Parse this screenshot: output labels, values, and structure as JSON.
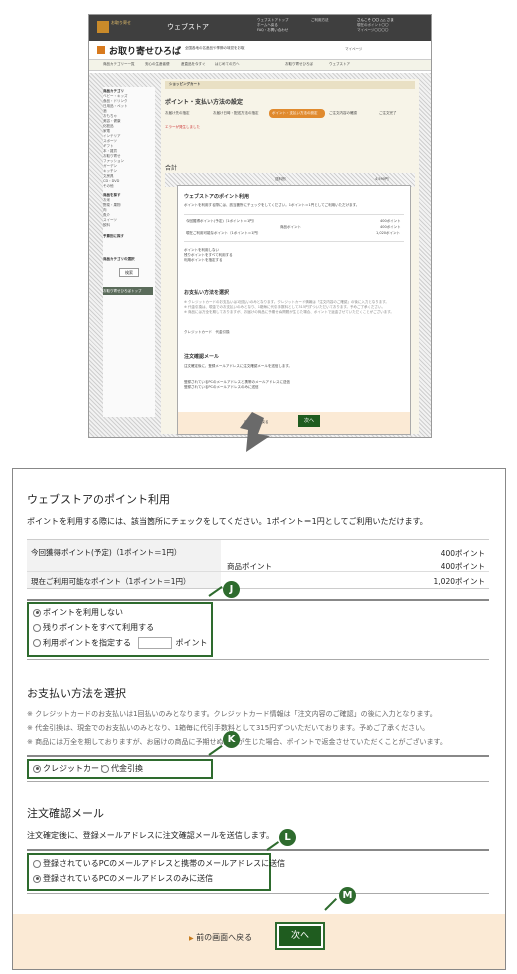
{
  "thumbnail": {
    "site_name": "ウェブストア",
    "header_links": [
      "ウェブストアトップ",
      "ご利用方法",
      "ホームへ戻る",
      "FAQ・お問い合わせ"
    ],
    "header_user": "さんこそ 〇〇 △△ さま",
    "header_user_sub": [
      "現在のポイント〇〇",
      "マイページ〇〇〇〇"
    ],
    "mypage": "マイページ",
    "section_title": "お取り寄せひろば",
    "section_desc": "全国各地の名産品や季節の味覚をお取り寄せ",
    "nav_items": [
      "商品カテゴリー一覧",
      "安心の生産者便",
      "産直品を今すぐ",
      "はじめての方へ"
    ],
    "nav_right": [
      "お取り寄せひろば",
      "ウェブストア"
    ],
    "sidebar_title": "商品カテゴリ",
    "sidebar_items": [
      "ベビー・キッズ",
      "食品・ドリンク",
      "日用品・ペット",
      "酒",
      "おもちゃ",
      "美容・健康",
      "化粧品",
      "家電",
      "インテリア",
      "スポーツ",
      "ギフト",
      "本・雑貨",
      "お取り寄せ",
      "ファッション",
      "ガーデン",
      "キッチン",
      "文房具",
      "CD・DVD",
      "その他"
    ],
    "sidebar_title2": "商品を探す",
    "sidebar_items2": [
      "お米",
      "野菜・果物",
      "肉",
      "魚介",
      "スイーツ",
      "飲料"
    ],
    "sidebar_title3": "予算別に探す",
    "sidebar_title4": "商品カテゴリの選択",
    "sidebar_button": "検索",
    "sidebar_bottom": "お取り寄せひろばトップ",
    "cart_label": "ショッピングカート",
    "step_title": "ポイント・支払い方法の設定",
    "steps": [
      "お届け先の指定",
      "お届け日時・配送方法の指定",
      "ポイント・支払い方法の設定",
      "ご注文内容の確認",
      "ご注文完了"
    ],
    "error_text": "エラーが発生しました",
    "total_label": "合計",
    "total_sub": "送料別",
    "total_value": "4,590円"
  },
  "points": {
    "title": "ウェブストアのポイント利用",
    "desc": "ポイントを利用する際には、該当箇所にチェックをしてください。1ポイント＝1円としてご利用いただけます。",
    "rows": [
      {
        "label": "今回獲得ポイント(予定)（1ポイント＝1円）",
        "sub_label": "",
        "value": "400ポイント"
      },
      {
        "label": "",
        "sub_label": "商品ポイント",
        "value": "400ポイント"
      },
      {
        "label": "現在ご利用可能なポイント（1ポイント＝1円）",
        "sub_label": "",
        "value": "1,020ポイント"
      }
    ],
    "options": {
      "none": "ポイントを利用しない",
      "all": "残りポイントをすべて利用する",
      "specify": "利用ポイントを指定する",
      "unit": "ポイント"
    }
  },
  "payment": {
    "title": "お支払い方法を選択",
    "notes": [
      "※ クレジットカードのお支払いは1回払いのみとなります。クレジットカード情報は「注文内容のご確認」の後に入力となります。",
      "※ 代金引換は、現金でのお支払いのみとなり、1箱毎に代引手数料として315円ずついただいております。予めご了承ください。",
      "※ 商品には万全を期しておりますが、お届けの商品に予期せぬ問題が生じた場合、ポイントで返金させていただくことがございます。"
    ],
    "options": {
      "credit": "クレジットカード",
      "cod": "代金引換"
    }
  },
  "email": {
    "title": "注文確認メール",
    "desc": "注文確定後に、登録メールアドレスに注文確認メールを送信します。",
    "options": {
      "both": "登録されているPCのメールアドレスと携帯のメールアドレスに送信",
      "pc": "登録されているPCのメールアドレスのみに送信"
    }
  },
  "footer": {
    "back": "前の画面へ戻る",
    "next": "次へ"
  },
  "badges": {
    "j": "J",
    "k": "K",
    "l": "L",
    "m": "M"
  },
  "colors": {
    "highlight": "#2e6b2e",
    "footer_bg": "#fbead5",
    "step_active": "#e08a2e",
    "header_bg": "#3f3f3f",
    "accent_orange": "#d87a1e"
  }
}
